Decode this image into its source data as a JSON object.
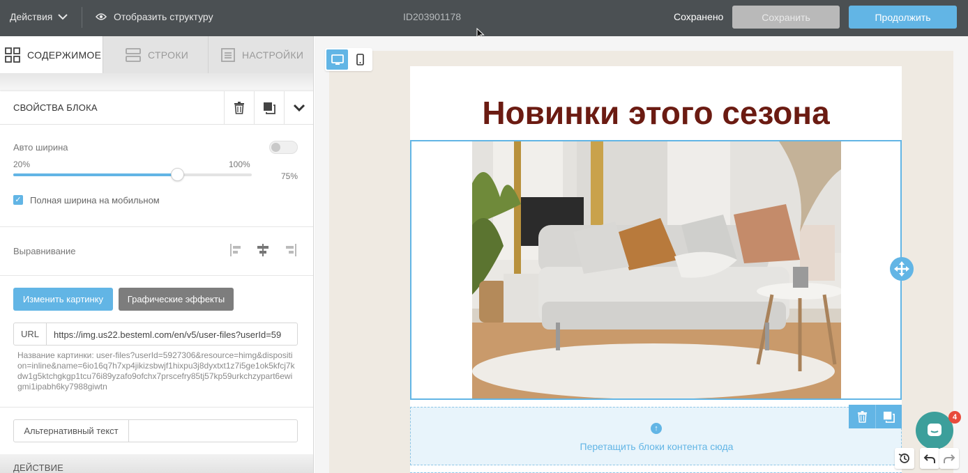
{
  "topbar": {
    "actions_label": "Действия",
    "structure_label": "Отобразить структуру",
    "doc_id": "ID203901178",
    "saved_status": "Сохранено",
    "save_label": "Сохранить",
    "continue_label": "Продолжить"
  },
  "tabs": [
    {
      "label": "СОДЕРЖИМОЕ",
      "icon": "grid-icon",
      "active": true
    },
    {
      "label": "СТРОКИ",
      "icon": "rows-icon",
      "active": false
    },
    {
      "label": "НАСТРОЙКИ",
      "icon": "settings-icon",
      "active": false
    }
  ],
  "block_props": {
    "title": "СВОЙСТВА БЛОКА",
    "auto_width_label": "Авто ширина",
    "auto_width_on": false,
    "slider_min_label": "20%",
    "slider_max_label": "100%",
    "slider_value_label": "75%",
    "slider_value": 0.75,
    "full_width_mobile_label": "Полная ширина на мобильном",
    "full_width_mobile_checked": true,
    "alignment_label": "Выравнивание",
    "change_image_label": "Изменить картинку",
    "effects_label": "Графические эффекты",
    "url_label": "URL",
    "url_value": "https://img.us22.besteml.com/en/v5/user-files?userId=59",
    "image_name": "Название картинки:  user-files?userId=5927306&resource=himg&disposition=inline&name=6io16q7h7xp4jikizsbwjf1hixpu3j8dyxtxt1z7i5ge1ok5kfcj7kdw1g5ktchgkgp1tcu76i89yzafo9ofchx7prscefry85tj57kp59urkchzypart6ewigmi1ipabh6ky7988giwtn",
    "alt_text_label": "Альтернативный текст",
    "alt_text_value": "",
    "action_section": "ДЕЙСТВИЕ"
  },
  "canvas": {
    "heading": "Новинки этого сезона",
    "drop_zone_text": "Перетащить блоки контента сюда",
    "chat_badge_count": "4"
  },
  "colors": {
    "accent": "#62b5e5",
    "heading": "#6b1b12",
    "topbar": "#4b5053",
    "chat": "#3c9f9b",
    "badge": "#e84b3c"
  }
}
